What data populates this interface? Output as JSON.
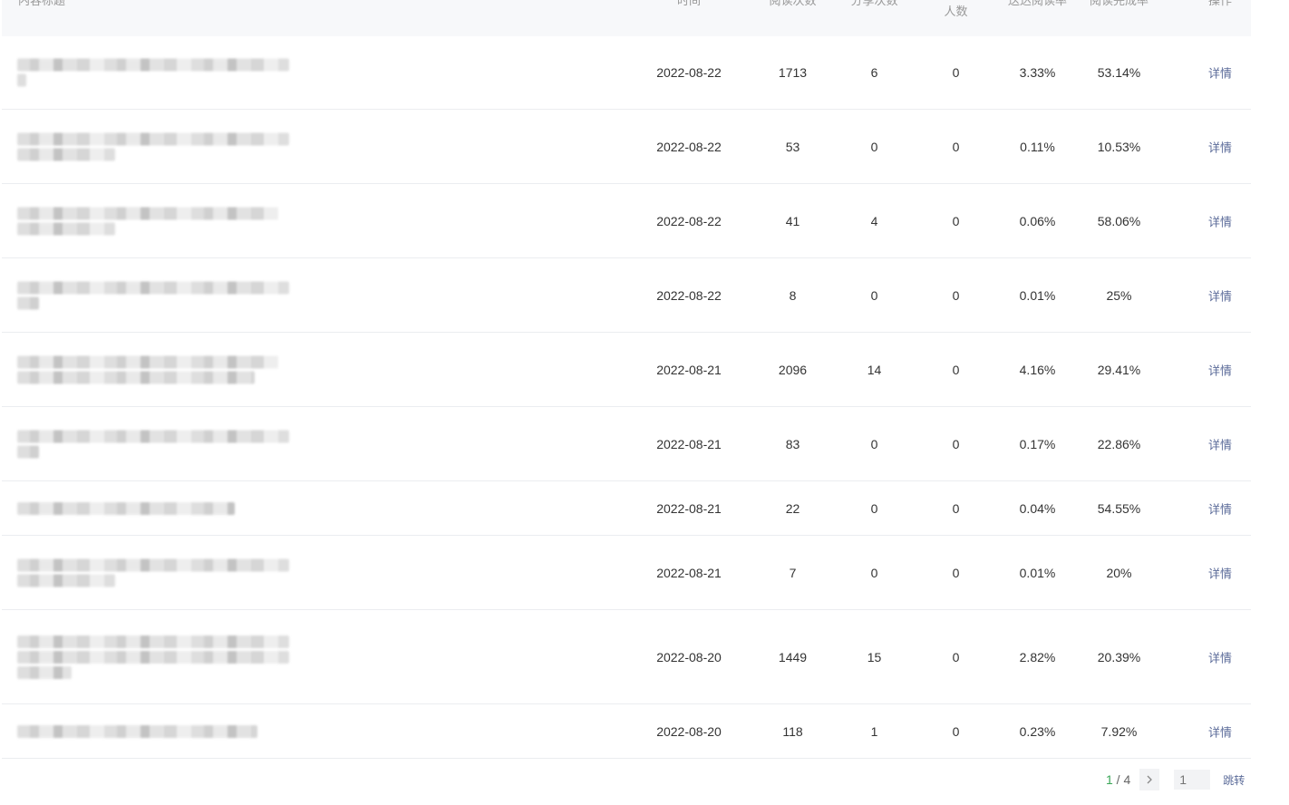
{
  "table": {
    "headers": {
      "title": "内容标题",
      "time": "时间",
      "reads": "阅读次数",
      "shares": "分享次数",
      "people": "人数",
      "reach_rate": "送达阅读率",
      "complete_rate": "阅读完成率",
      "action": "操作"
    },
    "rows": [
      {
        "date": "2022-08-22",
        "reads": "1713",
        "shares": "6",
        "people": "0",
        "reach": "3.33%",
        "complete": "53.14%",
        "op": "详情"
      },
      {
        "date": "2022-08-22",
        "reads": "53",
        "shares": "0",
        "people": "0",
        "reach": "0.11%",
        "complete": "10.53%",
        "op": "详情"
      },
      {
        "date": "2022-08-22",
        "reads": "41",
        "shares": "4",
        "people": "0",
        "reach": "0.06%",
        "complete": "58.06%",
        "op": "详情"
      },
      {
        "date": "2022-08-22",
        "reads": "8",
        "shares": "0",
        "people": "0",
        "reach": "0.01%",
        "complete": "25%",
        "op": "详情"
      },
      {
        "date": "2022-08-21",
        "reads": "2096",
        "shares": "14",
        "people": "0",
        "reach": "4.16%",
        "complete": "29.41%",
        "op": "详情"
      },
      {
        "date": "2022-08-21",
        "reads": "83",
        "shares": "0",
        "people": "0",
        "reach": "0.17%",
        "complete": "22.86%",
        "op": "详情"
      },
      {
        "date": "2022-08-21",
        "reads": "22",
        "shares": "0",
        "people": "0",
        "reach": "0.04%",
        "complete": "54.55%",
        "op": "详情"
      },
      {
        "date": "2022-08-21",
        "reads": "7",
        "shares": "0",
        "people": "0",
        "reach": "0.01%",
        "complete": "20%",
        "op": "详情"
      },
      {
        "date": "2022-08-20",
        "reads": "1449",
        "shares": "15",
        "people": "0",
        "reach": "2.82%",
        "complete": "20.39%",
        "op": "详情"
      },
      {
        "date": "2022-08-20",
        "reads": "118",
        "shares": "1",
        "people": "0",
        "reach": "0.23%",
        "complete": "7.92%",
        "op": "详情"
      }
    ]
  },
  "pagination": {
    "current": "1",
    "separator": " / ",
    "total": "4",
    "next_icon": "chevron-right-icon",
    "input_placeholder": "1",
    "go_label": "跳转"
  },
  "colors": {
    "link": "#5b6b99",
    "page_current": "#3aa657",
    "header_bg": "#f7f8fa"
  }
}
